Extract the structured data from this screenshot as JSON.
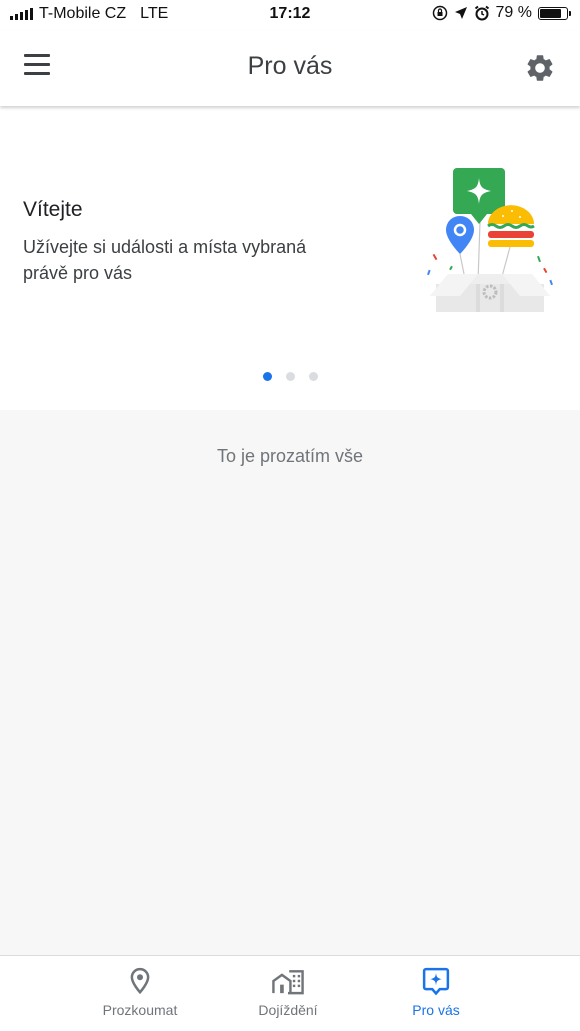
{
  "status_bar": {
    "carrier": "T-Mobile CZ",
    "network": "LTE",
    "time": "17:12",
    "battery": "79 %",
    "battery_level": 0.79
  },
  "app_bar": {
    "title": "Pro vás",
    "menu_icon": "hamburger-menu-icon",
    "settings_icon": "gear-icon"
  },
  "welcome": {
    "title": "Vítejte",
    "text": "Užívejte si události a místa vybraná právě pro vás",
    "page_count": 3,
    "active_page": 1
  },
  "feed": {
    "end_text": "To je prozatím vše"
  },
  "bottom_nav": {
    "items": [
      {
        "label": "Prozkoumat",
        "icon": "location-pin-icon",
        "active": false
      },
      {
        "label": "Dojíždění",
        "icon": "buildings-icon",
        "active": false
      },
      {
        "label": "Pro vás",
        "icon": "sparkle-icon",
        "active": true
      }
    ]
  },
  "colors": {
    "accent": "#1a73e8",
    "inactive": "#70757a",
    "background": "#f7f7f7"
  }
}
